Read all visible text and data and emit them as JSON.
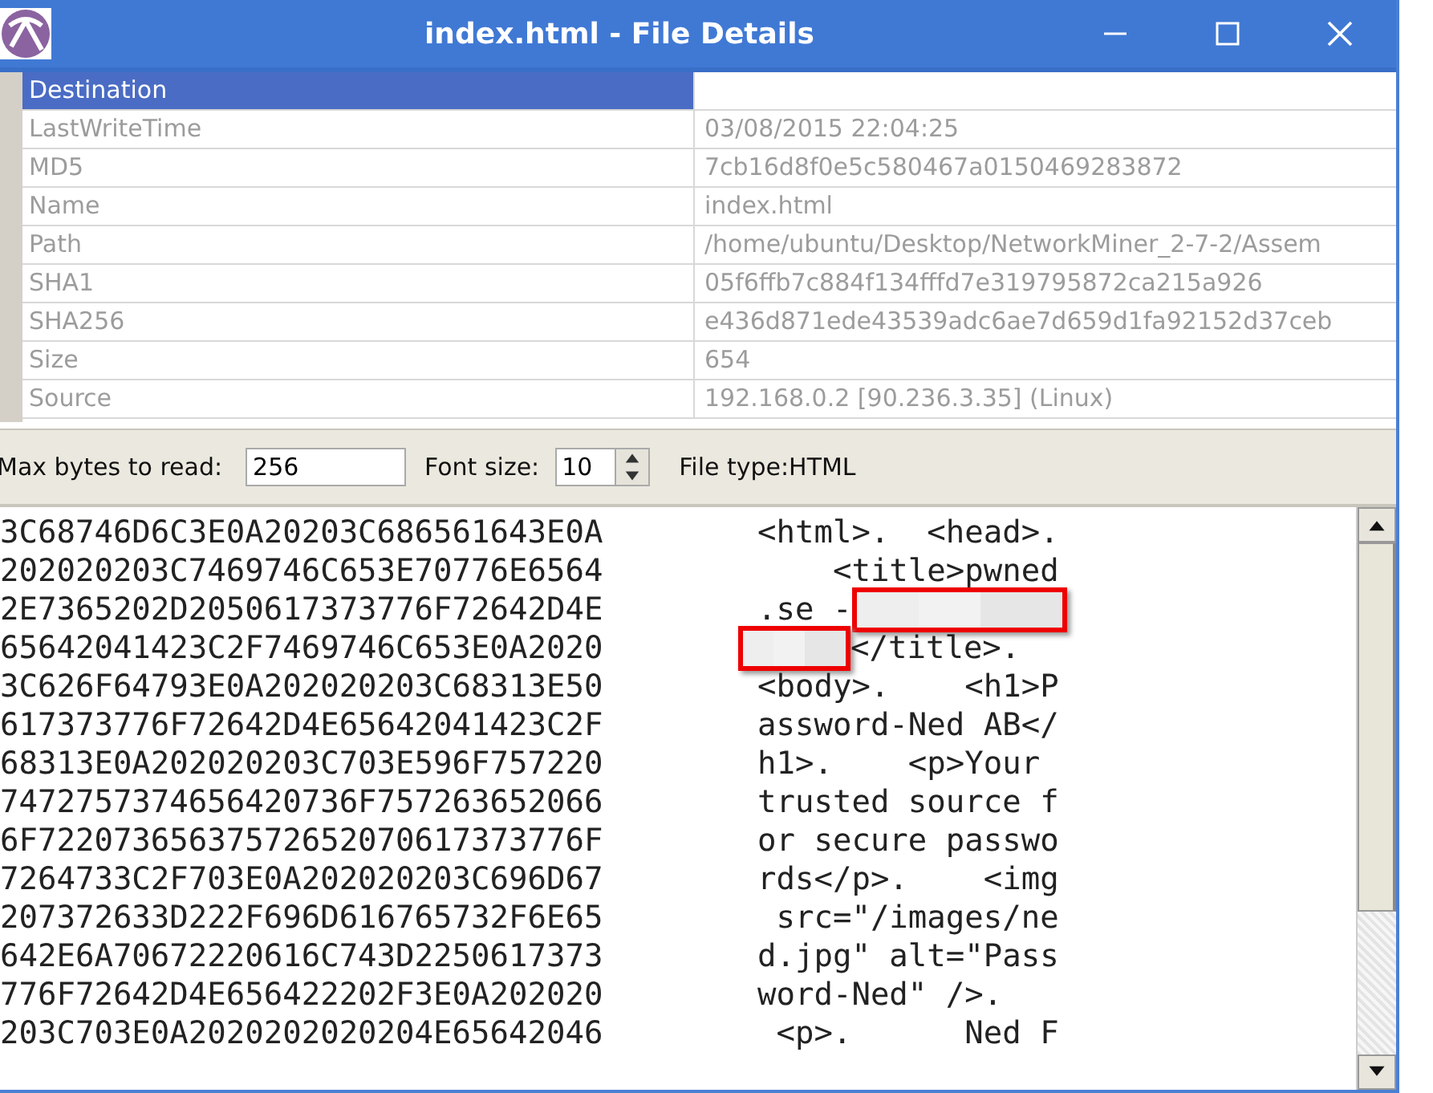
{
  "window": {
    "title": "index.html - File Details"
  },
  "table": {
    "rows": [
      {
        "label": "Destination",
        "value": "",
        "selected": true
      },
      {
        "label": "LastWriteTime",
        "value": "03/08/2015 22:04:25",
        "selected": false
      },
      {
        "label": "MD5",
        "value": "7cb16d8f0e5c580467a0150469283872",
        "selected": false
      },
      {
        "label": "Name",
        "value": "index.html",
        "selected": false
      },
      {
        "label": "Path",
        "value": "/home/ubuntu/Desktop/NetworkMiner_2-7-2/Assem",
        "selected": false
      },
      {
        "label": "SHA1",
        "value": "05f6ffb7c884f134fffd7e319795872ca215a926",
        "selected": false
      },
      {
        "label": "SHA256",
        "value": "e436d871ede43539adc6ae7d659d1fa92152d37ceb",
        "selected": false
      },
      {
        "label": "Size",
        "value": "654",
        "selected": false
      },
      {
        "label": "Source",
        "value": "192.168.0.2 [90.236.3.35] (Linux)",
        "selected": false
      }
    ]
  },
  "toolbar": {
    "max_bytes_label": "Max bytes to read:",
    "max_bytes_value": "256",
    "font_size_label": "Font size:",
    "font_size_value": "10",
    "file_type": "File type:HTML"
  },
  "hex_lines": [
    "3C68746D6C3E0A20203C686561643E0A",
    "202020203C7469746C653E70776E6564",
    "2E7365202D2050617373776F72642D4E",
    "65642041423C2F7469746C653E0A2020",
    "3C626F64793E0A202020203C68313E50",
    "617373776F72642D4E65642041423C2F",
    "68313E0A202020203C703E596F757220",
    "7472757374656420736F757263652066",
    "6F72207365637572652070617373776F",
    "7264733C2F703E0A202020203C696D67",
    "207372633D222F696D616765732F6E65",
    "642E6A70672220616C743D2250617373",
    "776F72642D4E656422202F3E0A202020",
    "203C703E0A2020202020204E65642046"
  ],
  "ascii_lines": [
    [
      {
        "kind": "text",
        "text": "<html>.  <head>."
      }
    ],
    [
      {
        "kind": "text",
        "text": "    <title>pwned"
      }
    ],
    [
      {
        "kind": "text",
        "text": ".se -"
      },
      {
        "kind": "redacted"
      }
    ],
    [
      {
        "kind": "redacted"
      },
      {
        "kind": "text",
        "text": "</title>."
      }
    ],
    [
      {
        "kind": "text",
        "text": "<body>.    <h1>P"
      }
    ],
    [
      {
        "kind": "text",
        "text": "assword-Ned AB</"
      }
    ],
    [
      {
        "kind": "text",
        "text": "h1>.    <p>Your"
      }
    ],
    [
      {
        "kind": "text",
        "text": "trusted source f"
      }
    ],
    [
      {
        "kind": "text",
        "text": "or secure passwo"
      }
    ],
    [
      {
        "kind": "text",
        "text": "rds</p>.    <img"
      }
    ],
    [
      {
        "kind": "text",
        "text": " src=\"/images/ne"
      }
    ],
    [
      {
        "kind": "text",
        "text": "d.jpg\" alt=\"Pass"
      }
    ],
    [
      {
        "kind": "text",
        "text": "word-Ned\" />."
      }
    ],
    [
      {
        "kind": "text",
        "text": " <p>.      Ned F"
      }
    ]
  ]
}
